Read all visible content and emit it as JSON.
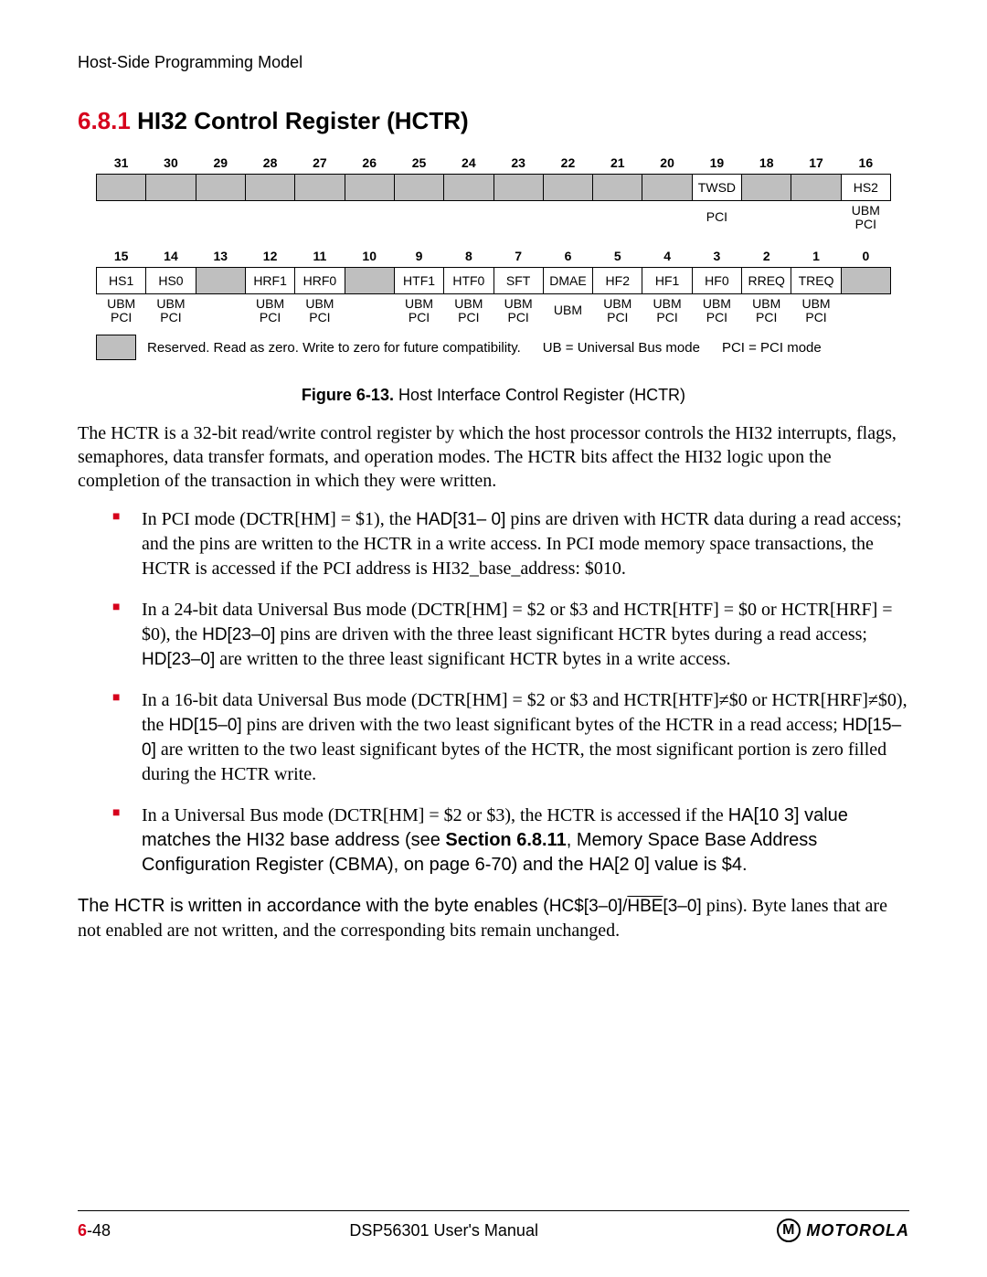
{
  "header": "Host-Side Programming Model",
  "section": {
    "number": "6.8.1",
    "title": "HI32 Control Register (HCTR)"
  },
  "register": {
    "high": {
      "bits": [
        "31",
        "30",
        "29",
        "28",
        "27",
        "26",
        "25",
        "24",
        "23",
        "22",
        "21",
        "20",
        "19",
        "18",
        "17",
        "16"
      ],
      "fields": [
        "",
        "",
        "",
        "",
        "",
        "",
        "",
        "",
        "",
        "",
        "",
        "",
        "TWSD",
        "",
        "",
        "HS2"
      ],
      "reserved": [
        true,
        true,
        true,
        true,
        true,
        true,
        true,
        true,
        true,
        true,
        true,
        true,
        false,
        true,
        true,
        false
      ],
      "modes": [
        "",
        "",
        "",
        "",
        "",
        "",
        "",
        "",
        "",
        "",
        "",
        "",
        "PCI",
        "",
        "",
        "UBM PCI"
      ]
    },
    "low": {
      "bits": [
        "15",
        "14",
        "13",
        "12",
        "11",
        "10",
        "9",
        "8",
        "7",
        "6",
        "5",
        "4",
        "3",
        "2",
        "1",
        "0"
      ],
      "fields": [
        "HS1",
        "HS0",
        "",
        "HRF1",
        "HRF0",
        "",
        "HTF1",
        "HTF0",
        "SFT",
        "DMAE",
        "HF2",
        "HF1",
        "HF0",
        "RREQ",
        "TREQ",
        ""
      ],
      "reserved": [
        false,
        false,
        true,
        false,
        false,
        true,
        false,
        false,
        false,
        false,
        false,
        false,
        false,
        false,
        false,
        true
      ],
      "modes": [
        "UBM PCI",
        "UBM PCI",
        "",
        "UBM PCI",
        "UBM PCI",
        "",
        "UBM PCI",
        "UBM PCI",
        "UBM PCI",
        "UBM",
        "UBM PCI",
        "UBM PCI",
        "UBM PCI",
        "UBM PCI",
        "UBM PCI",
        ""
      ]
    }
  },
  "legend": {
    "reserved": "Reserved. Read as zero. Write to zero for future compatibility.",
    "ub": "UB = Universal Bus mode",
    "pci": "PCI = PCI mode"
  },
  "figure": {
    "label": "Figure 6-13.",
    "caption": "Host Interface Control Register (HCTR)"
  },
  "para_intro": "The HCTR is a 32-bit read/write control register by which the host processor controls the HI32 interrupts, flags, semaphores, data transfer formats, and operation modes. The HCTR bits affect the HI32 logic upon the completion of the transaction in which they were written.",
  "bullets": {
    "b1": {
      "t1": "In PCI mode (DCTR[HM] = $1), the ",
      "code1": "HAD[31– 0]",
      "t2": " pins are driven with HCTR data during a read access; and the pins are written to the HCTR in a write access. In PCI mode memory space transactions, the HCTR is accessed if the PCI address is HI32_base_address: $010."
    },
    "b2": {
      "t1": "In a 24-bit data Universal Bus mode (DCTR[HM] = $2 or $3 and HCTR[HTF] = $0 or HCTR[HRF] = $0), the ",
      "code1": "HD[23–0]",
      "t2": " pins are driven with the three least significant HCTR bytes during a read access; ",
      "code2": "HD[23–0]",
      "t3": " are written to the three least significant HCTR bytes in a write access."
    },
    "b3": {
      "t1": "In a 16-bit data Universal Bus mode (DCTR[HM] = $2 or $3 and HCTR[HTF]≠$0 or HCTR[HRF]≠$0), the ",
      "code1": "HD[15–0]",
      "t2": " pins are driven with the two least significant bytes of the HCTR in a read access; ",
      "code2": "HD[15–0]",
      "t3": " are written to the two least significant bytes of the HCTR, the most significant portion is zero filled during the HCTR write."
    },
    "b4": {
      "t1": "In a Universal Bus mode (DCTR[HM] = $2 or $3), the HCTR is accessed if the ",
      "t2": "HA[10 3] value matches the HI32 base address (see ",
      "bold": "Section 6.8.11",
      "t3": ",  Memory Space Base Address Configuration Register (CBMA), ",
      "t4": "on page 6-70) and the HA[2 0] value is $4."
    }
  },
  "para_outro": {
    "t1": "The HCTR is written in accordance with the byte enables (",
    "code1": "HC$[3–0]",
    "over": "HBE",
    "code2": "[3–0]",
    "t2": " pins). Byte lanes that are not enabled are not written, and the corresponding bits remain unchanged."
  },
  "footer": {
    "page_chapter": "6",
    "page_num": "-48",
    "center": "DSP56301 User's Manual",
    "brand": "MOTOROLA"
  }
}
